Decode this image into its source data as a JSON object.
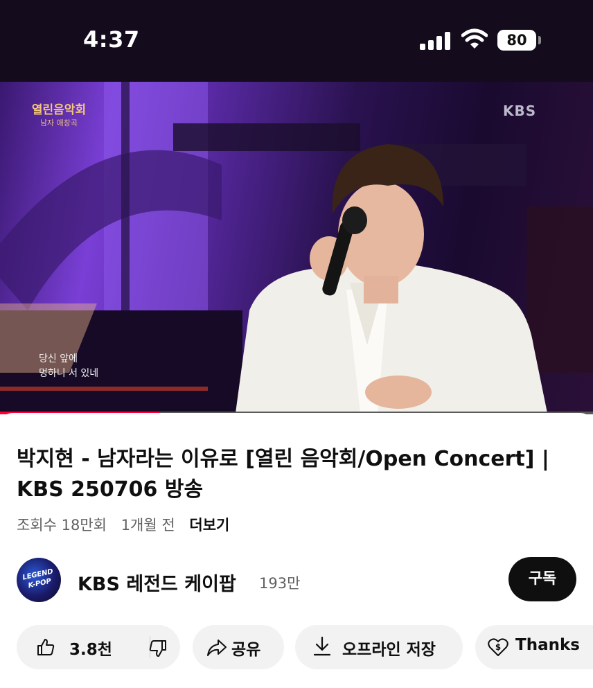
{
  "status_bar": {
    "time": "4:37",
    "battery": "80"
  },
  "video": {
    "show_logo_line1": "열린음악회",
    "show_logo_line2": "남자 애창곡",
    "broadcaster": "KBS",
    "subtitle_line1": "당신 앞에",
    "subtitle_line2": "멍하니 서 있네",
    "progress_fraction": 0.27,
    "progress_color": "#ff0033"
  },
  "info": {
    "title": "박지현 - 남자라는 이유로 [열린 음악회/Open Concert] | KBS 250706 방송",
    "views": "조회수 18만회",
    "age": "1개월 전",
    "more": "더보기"
  },
  "channel": {
    "avatar_text_line1": "LEGEND",
    "avatar_text_line2": "K-POP",
    "name": "KBS 레전드 케이팝",
    "subscribers": "193만",
    "subscribe_label": "구독"
  },
  "actions": {
    "like_count": "3.8천",
    "share_label": "공유",
    "offline_label": "오프라인 저장",
    "thanks_label": "Thanks",
    "icons": [
      "thumbs-up-icon",
      "thumbs-down-icon",
      "share-arrow-icon",
      "download-icon",
      "heart-dollar-icon"
    ]
  }
}
